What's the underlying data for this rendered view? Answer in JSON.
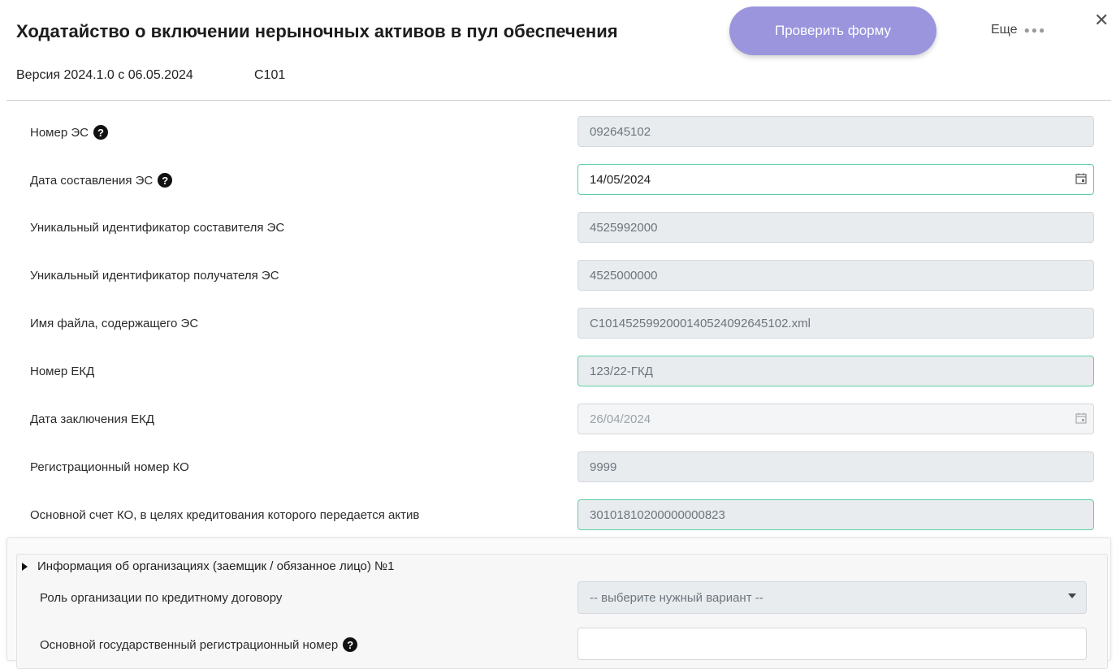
{
  "header": {
    "title": "Ходатайство о включении нерыночных активов в пул обеспечения",
    "check_button": "Проверить форму",
    "more_label": "Еще",
    "close_symbol": "✕",
    "version": "Версия 2024.1.0 с 06.05.2024",
    "form_code": "C101"
  },
  "fields": [
    {
      "label": "Номер ЭС",
      "help": true,
      "value": "092645102"
    },
    {
      "label": "Дата составления ЭС",
      "help": true,
      "value": "14/05/2024"
    },
    {
      "label": "Уникальный идентификатор составителя ЭС",
      "value": "4525992000"
    },
    {
      "label": "Уникальный идентификатор получателя ЭС",
      "value": "4525000000"
    },
    {
      "label": "Имя файла, содержащего ЭС",
      "value": "C1014525992000140524092645102.xml"
    },
    {
      "label": "Номер ЕКД",
      "value": "123/22-ГКД"
    },
    {
      "label": "Дата заключения ЕКД",
      "value": "26/04/2024"
    },
    {
      "label": "Регистрационный номер КО",
      "value": "9999"
    },
    {
      "label": "Основной счет КО, в целях кредитования которого передается актив",
      "value": "30101810200000000823"
    }
  ],
  "section": {
    "title": "Информация об организациях (заемщик / обязанное лицо) №1",
    "role_label": "Роль организации по кредитному договору",
    "role_select": "-- выберите нужный вариант --",
    "ogrn_label": "Основной государственный регистрационный номер",
    "ogrn_value": ""
  },
  "colors": {
    "accent_button": "#9a95dd",
    "valid_border": "#5fcfa3",
    "readonly_bg": "#e9ecef"
  }
}
